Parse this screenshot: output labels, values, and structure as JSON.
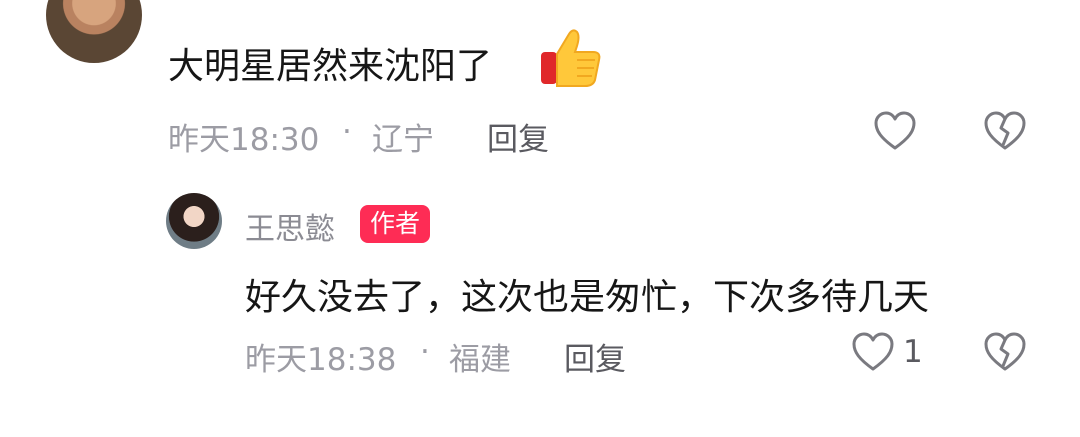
{
  "comments": [
    {
      "text": "大明星居然来沈阳了",
      "emoji": "thumbs-up-icon",
      "time": "昨天18:30",
      "separator": "·",
      "location": "辽宁",
      "reply_label": "回复"
    },
    {
      "username": "王思懿",
      "author_badge": "作者",
      "text": "好久没去了，这次也是匆忙，下次多待几天",
      "time": "昨天18:38",
      "separator": "·",
      "location": "福建",
      "reply_label": "回复",
      "like_count": "1"
    }
  ],
  "colors": {
    "badge": "#fe2c55",
    "meta": "#9c9ca4",
    "text": "#161616"
  }
}
